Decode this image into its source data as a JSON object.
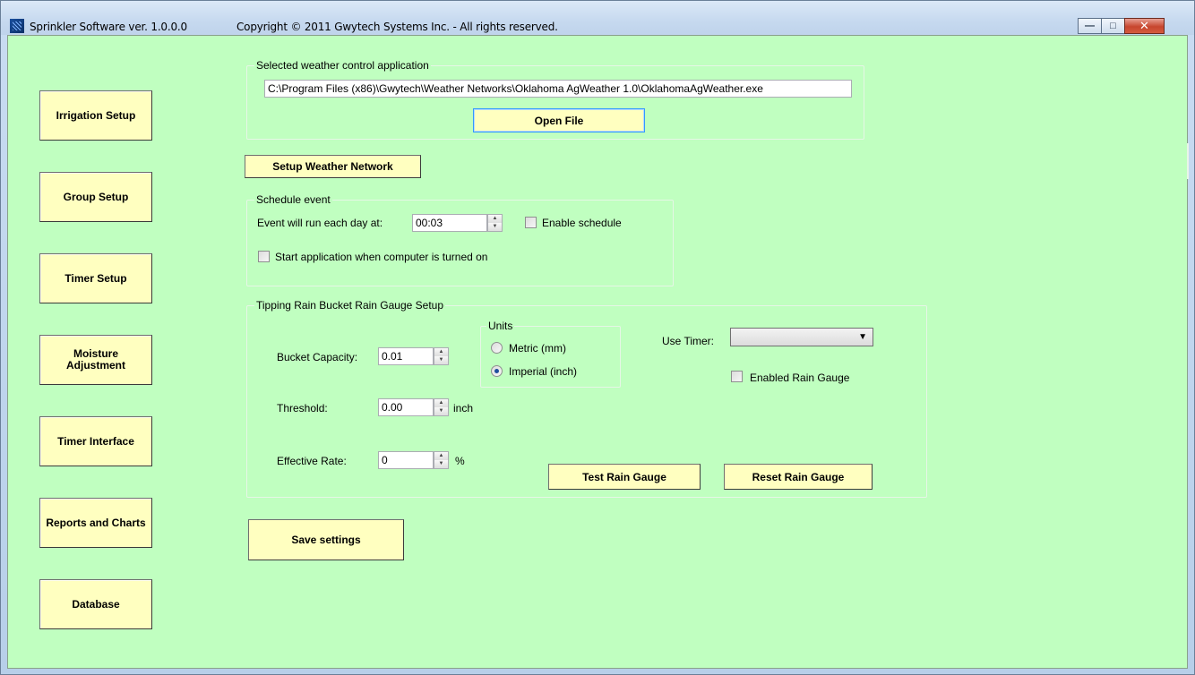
{
  "window": {
    "title": "Sprinkler Software ver. 1.0.0.0",
    "copyright": "Copyright © 2011 Gwytech Systems Inc. - All rights reserved.",
    "controls": {
      "minimize": "—",
      "maximize": "□",
      "close": "✕"
    }
  },
  "nav": {
    "irrigation_setup": "Irrigation Setup",
    "group_setup": "Group Setup",
    "timer_setup": "Timer Setup",
    "moisture_adjustment": "Moisture Adjustment",
    "timer_interface": "Timer Interface",
    "reports_and_charts": "Reports and Charts",
    "database": "Database"
  },
  "weather_app": {
    "legend": "Selected weather control application",
    "path": "C:\\Program Files (x86)\\Gwytech\\Weather Networks\\Oklahoma AgWeather 1.0\\OklahomaAgWeather.exe",
    "open_file": "Open File"
  },
  "setup_weather_network": "Setup Weather Network",
  "schedule": {
    "legend": "Schedule event",
    "run_label": "Event will run each day at:",
    "time_value": "00:03",
    "enable_schedule": "Enable schedule",
    "start_on_boot": "Start application when computer is turned on"
  },
  "rain_gauge": {
    "legend": "Tipping Rain Bucket Rain Gauge Setup",
    "bucket_capacity_label": "Bucket Capacity:",
    "bucket_capacity_value": "0.01",
    "threshold_label": "Threshold:",
    "threshold_value": "0.00",
    "threshold_unit": "inch",
    "effective_rate_label": "Effective Rate:",
    "effective_rate_value": "0",
    "effective_rate_unit": "%",
    "units_legend": "Units",
    "metric": "Metric (mm)",
    "imperial": "Imperial (inch)",
    "use_timer_label": "Use Timer:",
    "use_timer_value": "",
    "enabled_rain_gauge": "Enabled Rain Gauge",
    "test_button": "Test Rain Gauge",
    "reset_button": "Reset Rain Gauge"
  },
  "save_settings": "Save settings",
  "colors": {
    "client_background": "#c0ffc0",
    "button_background": "#ffffc0"
  }
}
